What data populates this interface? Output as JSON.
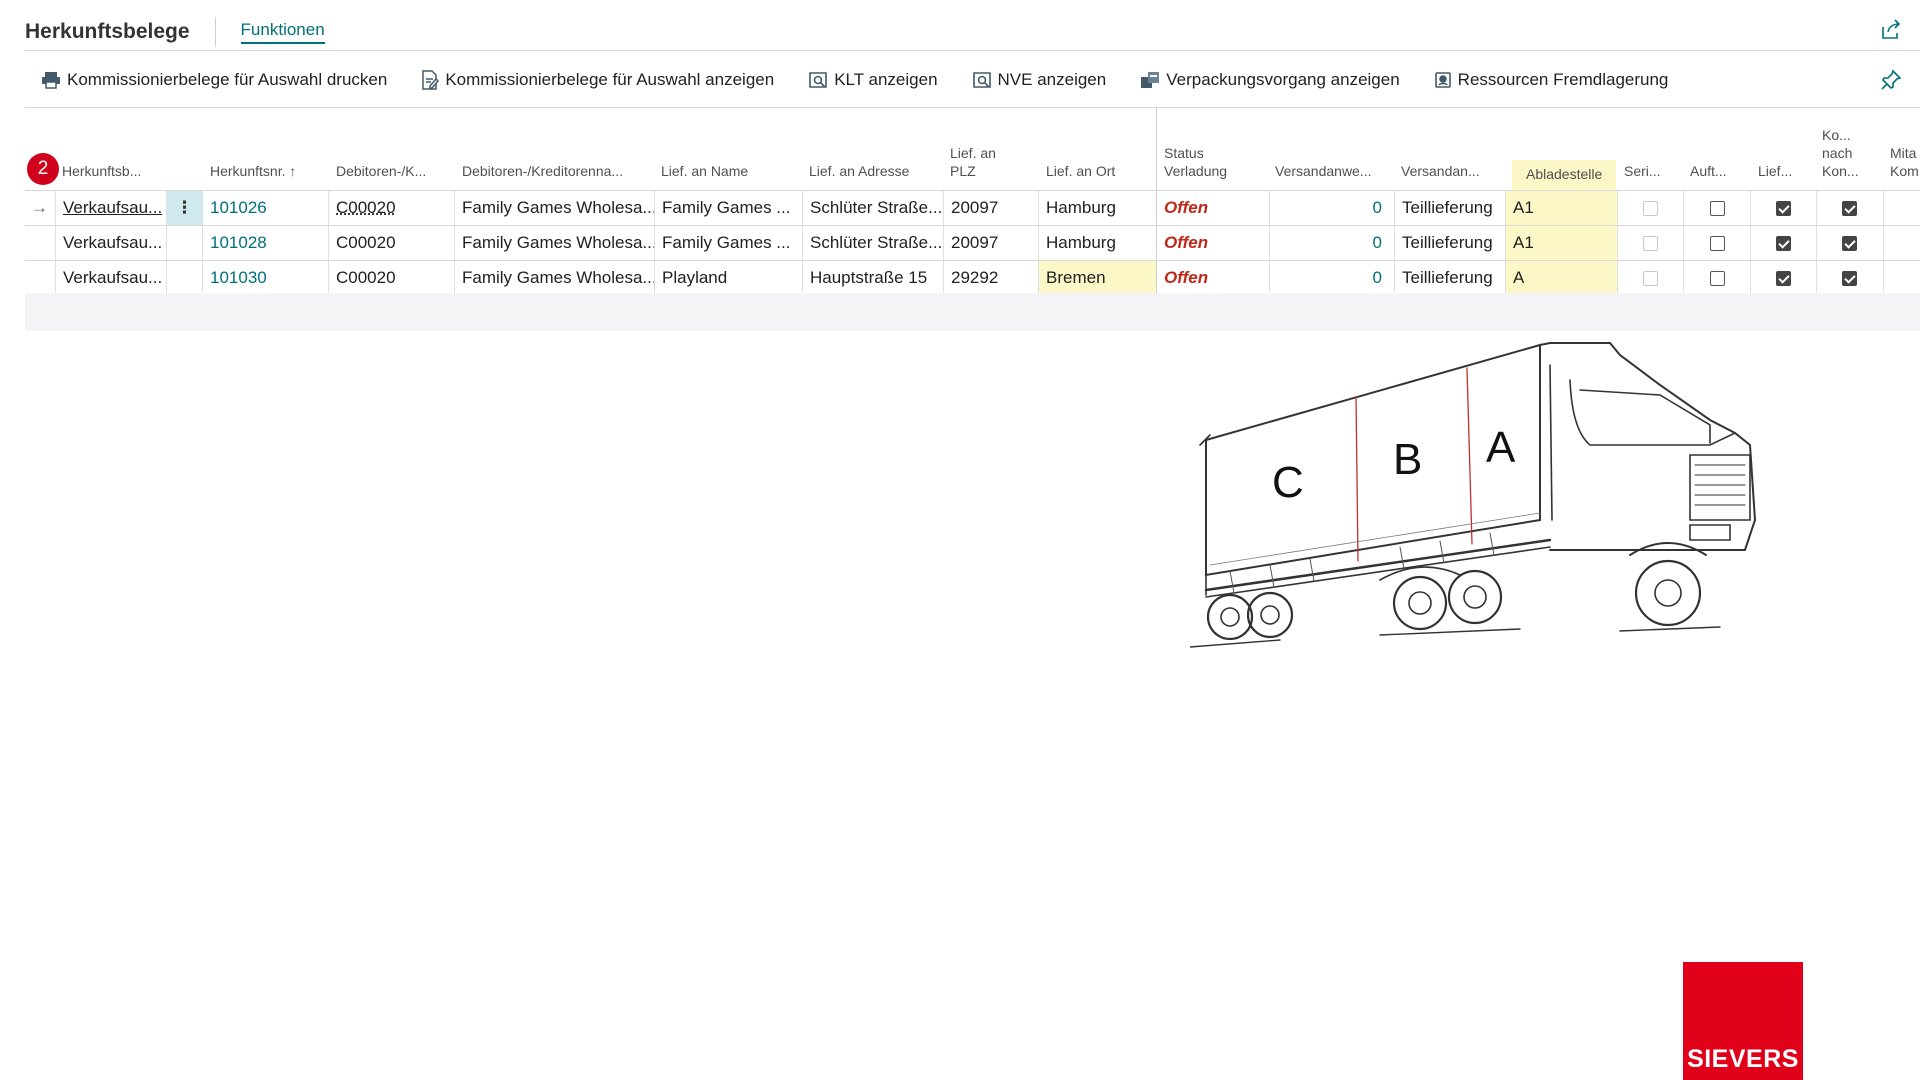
{
  "header": {
    "title": "Herkunftsbelege",
    "tab": "Funktionen"
  },
  "actions": [
    {
      "label": "Kommissionierbelege für Auswahl drucken",
      "icon": "printer-icon"
    },
    {
      "label": "Kommissionierbelege für Auswahl anzeigen",
      "icon": "document-edit-icon"
    },
    {
      "label": "KLT anzeigen",
      "icon": "search-list-icon"
    },
    {
      "label": "NVE anzeigen",
      "icon": "search-list-icon"
    },
    {
      "label": "Verpackungsvorgang anzeigen",
      "icon": "package-icon"
    },
    {
      "label": "Ressourcen Fremdlagerung",
      "icon": "resource-icon"
    }
  ],
  "badge": "2",
  "columns": {
    "herkunftsbeleg": "Herkunftsb...",
    "herkunftsnr": "Herkunftsnr.",
    "debitor_nr": "Debitoren-/K...",
    "debitor_name": "Debitoren-/Kreditorenna...",
    "lief_name": "Lief. an Name",
    "lief_adresse": "Lief. an Adresse",
    "lief_plz_1": "Lief. an",
    "lief_plz_2": "PLZ",
    "lief_ort": "Lief. an Ort",
    "status_1": "Status",
    "status_2": "Verladung",
    "versandanweisung": "Versandanwe...",
    "versandart": "Versandan...",
    "abladestelle": "Abladestelle",
    "seri": "Seri...",
    "auft": "Auft...",
    "lief": "Lief...",
    "ko_1": "Ko...",
    "ko_2": "nach",
    "ko_3": "Kon...",
    "mita_1": "Mita",
    "mita_2": "Kom"
  },
  "rows": [
    {
      "beleg": "Verkaufsau...",
      "nr": "101026",
      "debnr": "C00020",
      "debname": "Family Games Wholesa...",
      "liefname": "Family Games ...",
      "adresse": "Schlüter Straße...",
      "plz": "20097",
      "ort": "Hamburg",
      "status": "Offen",
      "versandanw": "0",
      "versandart": "Teillieferung",
      "ablade": "A1",
      "seri": false,
      "auft": false,
      "lief": true,
      "ko": true
    },
    {
      "beleg": "Verkaufsau...",
      "nr": "101028",
      "debnr": "C00020",
      "debname": "Family Games Wholesa...",
      "liefname": "Family Games ...",
      "adresse": "Schlüter Straße...",
      "plz": "20097",
      "ort": "Hamburg",
      "status": "Offen",
      "versandanw": "0",
      "versandart": "Teillieferung",
      "ablade": "A1",
      "seri": false,
      "auft": false,
      "lief": true,
      "ko": true
    },
    {
      "beleg": "Verkaufsau...",
      "nr": "101030",
      "debnr": "C00020",
      "debname": "Family Games Wholesa...",
      "liefname": "Playland",
      "adresse": "Hauptstraße 15",
      "plz": "29292",
      "ort": "Bremen",
      "status": "Offen",
      "versandanw": "0",
      "versandart": "Teillieferung",
      "ablade": "A",
      "seri": false,
      "auft": false,
      "lief": true,
      "ko": true
    }
  ],
  "truck_labels": {
    "c": "C",
    "b": "B",
    "a": "A"
  },
  "logo": {
    "text": "SIEVERS",
    "color": "#e1001a"
  }
}
